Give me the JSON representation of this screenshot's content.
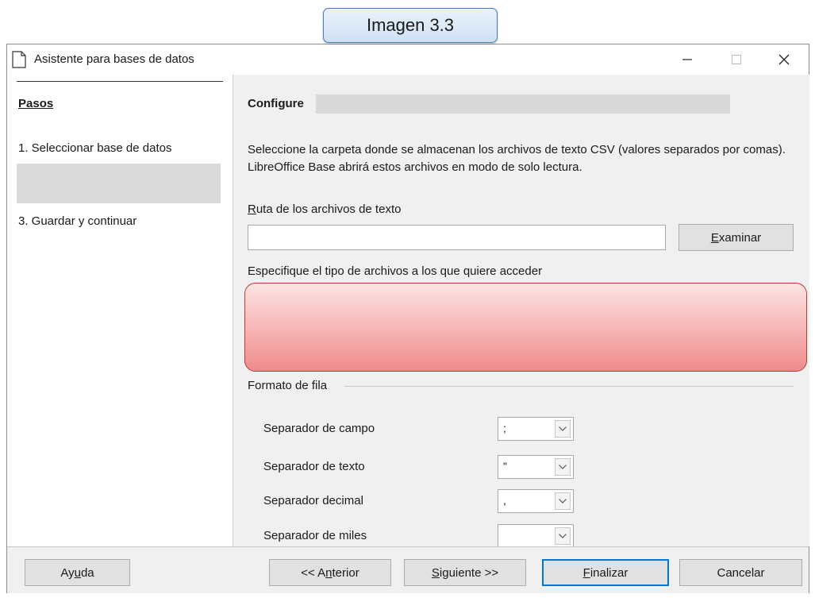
{
  "caption": "Imagen 3.3",
  "window": {
    "title": "Asistente para bases de datos",
    "controls": {
      "minimize": "—",
      "maximize": "☐",
      "close": "✕"
    }
  },
  "sidebar": {
    "title": "Pasos",
    "steps": [
      "1. Seleccionar base de datos",
      "3. Guardar y continuar"
    ]
  },
  "content": {
    "title": "Configure",
    "description": "Seleccione la carpeta donde se almacenan los archivos de texto CSV (valores separados por comas). LibreOffice Base abrirá estos archivos en modo de solo lectura.",
    "path_label_pre": "R",
    "path_label_post": "uta de los archivos de texto",
    "path_value": "",
    "browse_pre": "",
    "browse_key": "E",
    "browse_post": "xaminar",
    "file_type_label": "Especifique el tipo de archivos a los que quiere acceder",
    "row_format": {
      "title": "Formato de fila",
      "field_separator": {
        "label": "Separador de campo",
        "value": ";"
      },
      "text_separator": {
        "label": "Separador de texto",
        "value": "\""
      },
      "decimal_separator": {
        "label": "Separador decimal",
        "value": ","
      },
      "thousands_separator": {
        "label": "Separador de miles",
        "value": ""
      }
    }
  },
  "footer": {
    "help": {
      "pre": "Ay",
      "key": "u",
      "post": "da"
    },
    "back": {
      "pre": "<< A",
      "key": "n",
      "post": "terior"
    },
    "next": {
      "pre": "",
      "key": "S",
      "post": "iguiente >>"
    },
    "finish": {
      "pre": "",
      "key": "F",
      "post": "inalizar"
    },
    "cancel": "Cancelar"
  },
  "colors": {
    "accent": "#0078d7",
    "highlight_red": "#f08b8b",
    "caption_border": "#4a79b8"
  }
}
